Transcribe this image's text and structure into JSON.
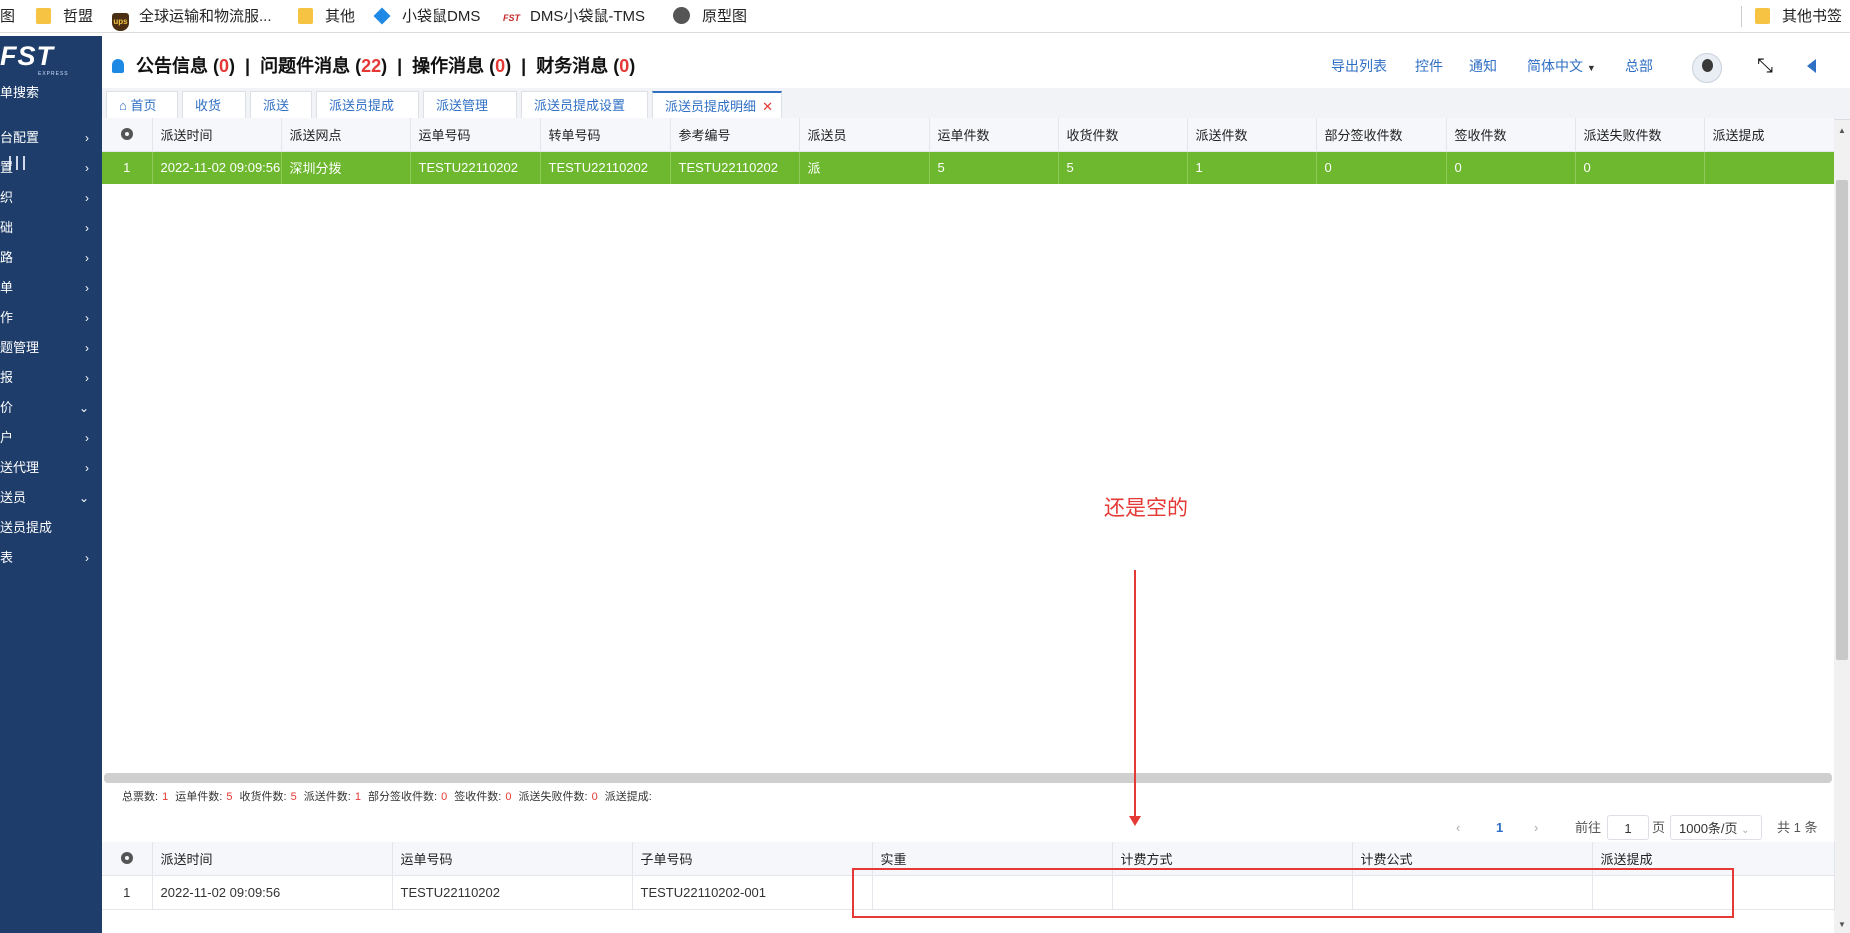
{
  "bookmarks": [
    {
      "label": "图",
      "icon": "none"
    },
    {
      "label": "哲盟",
      "icon": "folder-icon"
    },
    {
      "label": "全球运输和物流服...",
      "icon": "ups-icon"
    },
    {
      "label": "其他",
      "icon": "folder-icon"
    },
    {
      "label": "小袋鼠DMS",
      "icon": "kite-icon"
    },
    {
      "label": "DMS小袋鼠-TMS",
      "icon": "fst-icon"
    },
    {
      "label": "原型图",
      "icon": "globe-icon"
    },
    {
      "label": "其他书签",
      "icon": "folder-icon"
    }
  ],
  "sidebar": {
    "logo": "FST",
    "logo_sub": "EXPRESS",
    "search_label": "单搜索",
    "items": [
      {
        "label": "台配置",
        "arrow": "›"
      },
      {
        "label": "置",
        "arrow": "›"
      },
      {
        "label": "织",
        "arrow": "›"
      },
      {
        "label": "础",
        "arrow": "›"
      },
      {
        "label": "路",
        "arrow": "›"
      },
      {
        "label": "单",
        "arrow": "›"
      },
      {
        "label": "作",
        "arrow": "›"
      },
      {
        "label": "题管理",
        "arrow": "›"
      },
      {
        "label": "报",
        "arrow": "›"
      },
      {
        "label": "价",
        "arrow": "⌄"
      },
      {
        "label": "户",
        "arrow": "›"
      },
      {
        "label": "送代理",
        "arrow": "›"
      },
      {
        "label": "送员",
        "arrow": "⌄"
      },
      {
        "label": "送员提成",
        "arrow": ""
      },
      {
        "label": "表",
        "arrow": "›"
      }
    ]
  },
  "messages": {
    "announce": "公告信息",
    "announce_count": "0",
    "problem": "问题件消息",
    "problem_count": "22",
    "operation": "操作消息",
    "operation_count": "0",
    "finance": "财务消息",
    "finance_count": "0"
  },
  "toplinks": {
    "export": "导出列表",
    "control": "控件",
    "notify": "通知",
    "language": "简体中文",
    "hq": "总部"
  },
  "tabs": [
    "首页",
    "收货",
    "派送",
    "派送员提成",
    "派送管理",
    "派送员提成设置",
    "派送员提成明细"
  ],
  "main_table": {
    "columns": [
      "派送时间",
      "派送网点",
      "运单号码",
      "转单号码",
      "参考编号",
      "派送员",
      "运单件数",
      "收货件数",
      "派送件数",
      "部分签收件数",
      "签收件数",
      "派送失败件数",
      "派送提成"
    ],
    "rows": [
      [
        "1",
        "2022-11-02 09:09:56",
        "深圳分拨",
        "TESTU22110202",
        "TESTU22110202",
        "TESTU22110202",
        "派",
        "5",
        "5",
        "1",
        "0",
        "0",
        "0",
        ""
      ]
    ]
  },
  "summary": {
    "total_label": "总票数:",
    "total": "1",
    "waybill_label": "运单件数:",
    "waybill": "5",
    "received_label": "收货件数:",
    "received": "5",
    "delivered_label": "派送件数:",
    "delivered": "1",
    "partial_label": "部分签收件数:",
    "partial": "0",
    "signed_label": "签收件数:",
    "signed": "0",
    "failed_label": "派送失败件数:",
    "failed": "0",
    "commission_label": "派送提成:"
  },
  "pager": {
    "prev": "‹",
    "page": "1",
    "next": "›",
    "goto_label": "前往",
    "goto_value": "1",
    "page_unit": "页",
    "page_size": "1000条/页",
    "total_text": "共 1 条"
  },
  "detail_table": {
    "columns": [
      "派送时间",
      "运单号码",
      "子单号码",
      "实重",
      "计费方式",
      "计费公式",
      "派送提成"
    ],
    "rows": [
      [
        "1",
        "2022-11-02 09:09:56",
        "TESTU22110202",
        "TESTU22110202-001",
        "",
        "",
        "",
        ""
      ]
    ]
  },
  "annotation": {
    "text": "还是空的",
    "color": "#e53935"
  }
}
